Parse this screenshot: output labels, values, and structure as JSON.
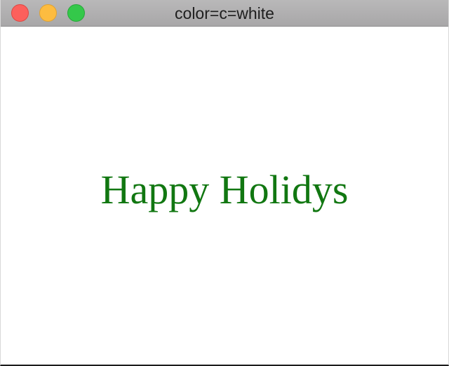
{
  "window": {
    "title": "color=c=white",
    "buttons": {
      "close": "close-button",
      "minimize": "minimize-button",
      "zoom": "zoom-button"
    }
  },
  "content": {
    "message": "Happy Holidys",
    "message_color": "#117711",
    "background_color": "#ffffff"
  }
}
